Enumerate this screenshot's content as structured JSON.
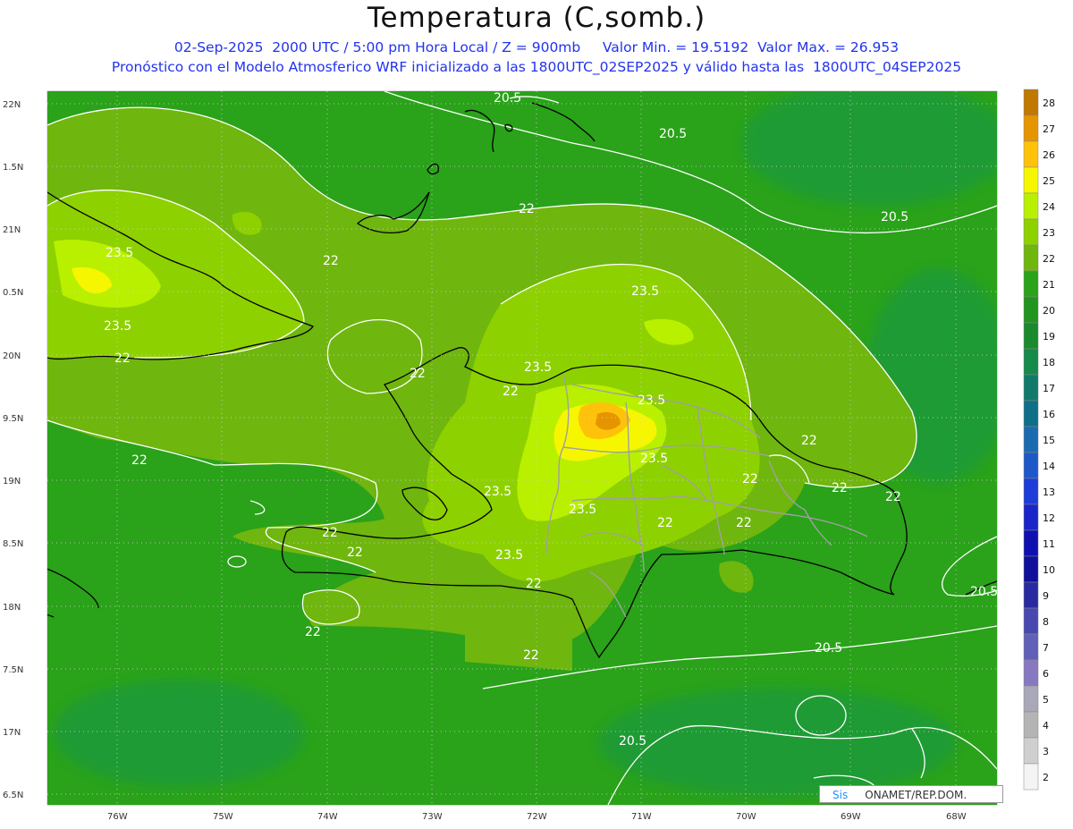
{
  "title": "Temperatura (C,somb.)",
  "subtitle_line1": "02-Sep-2025  2000 UTC / 5:00 pm Hora Local / Z = 900mb     Valor Min. = 19.5192  Valor Max. = 26.953",
  "subtitle_line2": "Pronóstico con el Modelo Atmosferico WRF inicializado a las 1800UTC_02SEP2025 y válido hasta las  1800UTC_04SEP2025",
  "credit": {
    "part1": "Sis",
    "part2": "ONAMET/REP.DOM."
  },
  "axes": {
    "lon_labels": [
      "76W",
      "75W",
      "74W",
      "73W",
      "72W",
      "71W",
      "70W",
      "69W",
      "68W"
    ],
    "lat_labels": [
      "22N",
      "1.5N",
      "21N",
      "0.5N",
      "20N",
      "9.5N",
      "19N",
      "8.5N",
      "18N",
      "7.5N",
      "17N",
      "6.5N"
    ]
  },
  "colorbar": {
    "labels": [
      "28",
      "27",
      "26",
      "25",
      "24",
      "23",
      "22",
      "21",
      "20",
      "19",
      "18",
      "17",
      "16",
      "15",
      "14",
      "13",
      "12",
      "11",
      "10",
      "9",
      "8",
      "7",
      "6",
      "5",
      "4",
      "3",
      "2"
    ],
    "colors": [
      "#c07800",
      "#e69500",
      "#ffc20a",
      "#f6f600",
      "#b9f000",
      "#8ed100",
      "#6fb60e",
      "#2aa21a",
      "#21951f",
      "#1a8a2f",
      "#168a4a",
      "#117a6a",
      "#0f6e88",
      "#1a6ab0",
      "#1e58c8",
      "#1e3cd8",
      "#1a26c8",
      "#1010b0",
      "#10109a",
      "#2a2aa0",
      "#4848b0",
      "#6060b8",
      "#8878c0",
      "#a8a8b8",
      "#b4b4b4",
      "#cfcfcf",
      "#f4f4f4"
    ]
  },
  "fill_colors": {
    "ocean": "#2aa21a",
    "band22": "#6fb60e",
    "band23": "#8ed100",
    "band24": "#b9f000",
    "band25": "#f6f600",
    "band26": "#ffc20a",
    "band27": "#e69500",
    "cool": "#1a9a3a"
  },
  "contour_labels": [
    "20.5",
    "20.5",
    "20.5",
    "22",
    "22",
    "22",
    "23.5",
    "23.5",
    "23.5",
    "22",
    "22",
    "23.5",
    "22",
    "23.5",
    "22",
    "23.5",
    "23.5",
    "22",
    "22",
    "22",
    "22",
    "22",
    "22",
    "22",
    "23.5",
    "23.5",
    "22",
    "22",
    "22",
    "20.5",
    "20.5",
    "20.5"
  ]
}
